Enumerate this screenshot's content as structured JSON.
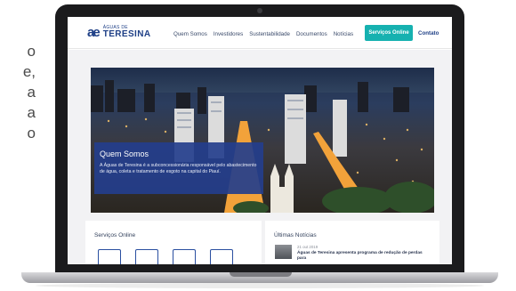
{
  "edge_text": [
    "o",
    "e,",
    "a",
    "a",
    "o"
  ],
  "site": {
    "logo": {
      "mark": "ae",
      "small": "ÁGUAS DE",
      "big": "TERESINA"
    },
    "nav": [
      "Quem Somos",
      "Investidores",
      "Sustentabilidade",
      "Documentos",
      "Notícias"
    ],
    "cta_label": "Serviços Online",
    "contact_label": "Contato"
  },
  "hero": {
    "title": "Quem Somos",
    "text": "A Águas de Teresina é a subconcessionária responsável pelo abastecimento de água, coleta e tratamento de esgoto na capital do Piauí."
  },
  "services": {
    "title": "Serviços Online",
    "icons": [
      "invoice-icon",
      "truck-icon",
      "calendar-icon",
      "document-icon"
    ]
  },
  "news": {
    "title": "Últimas Notícias",
    "items": [
      {
        "date": "21 out 2019",
        "headline": "Águas de Teresina apresenta programa de redução de perdas para"
      }
    ]
  },
  "colors": {
    "brand_blue": "#1e3f86",
    "cta_teal": "#16b1b0",
    "hero_box": "#243e8c"
  }
}
